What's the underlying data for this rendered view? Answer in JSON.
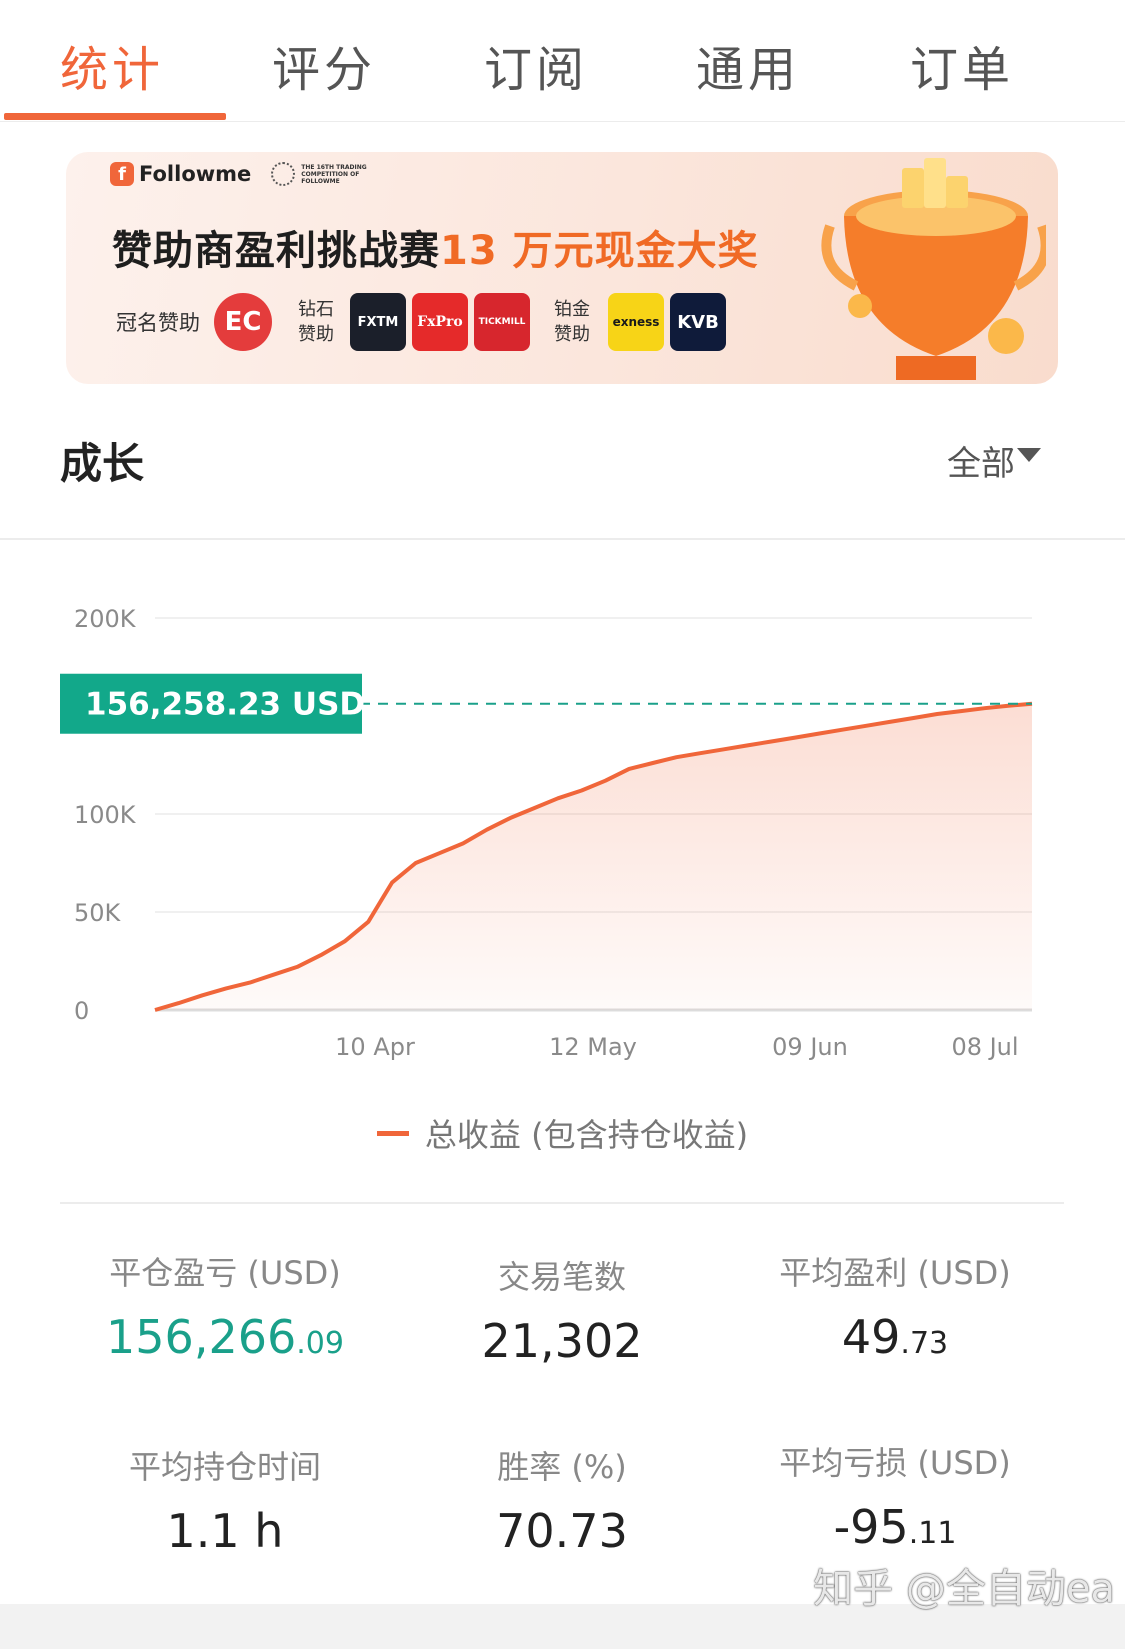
{
  "tabs": [
    {
      "label": "统计",
      "active": true
    },
    {
      "label": "评分",
      "active": false
    },
    {
      "label": "订阅",
      "active": false
    },
    {
      "label": "通用",
      "active": false
    },
    {
      "label": "订单",
      "active": false
    }
  ],
  "banner": {
    "brand": "Followme",
    "brand_icon": "f-logo-icon",
    "competition_text": "THE 16TH TRADING COMPETITION OF FOLLOWME",
    "headline_main": "赞助商盈利挑战赛",
    "headline_highlight": "13 万元现金大奖",
    "title_sponsor_label": "冠名赞助",
    "title_sponsor": "EC",
    "diamond_label": "钻石赞助",
    "diamond_sponsors": [
      "FXTM",
      "FxPro",
      "TICKMILL"
    ],
    "platinum_label": "铂金赞助",
    "platinum_sponsors": [
      "exness",
      "KVB"
    ],
    "colors": {
      "accent": "#f06a25"
    }
  },
  "section": {
    "title": "成长",
    "filter": "全部",
    "filter_icon": "caret-down-icon"
  },
  "chart_data": {
    "type": "area",
    "y_ticks": [
      "200K",
      "100K",
      "50K",
      "0"
    ],
    "y_tick_values": [
      200000,
      100000,
      50000,
      0
    ],
    "x_ticks": [
      "10 Apr",
      "12 May",
      "09 Jun",
      "08 Jul"
    ],
    "series": [
      {
        "name": "总收益 (包含持仓收益)",
        "color": "#f0663a",
        "values": [
          0,
          3500,
          7500,
          11000,
          14000,
          18000,
          22000,
          28000,
          35000,
          45000,
          65000,
          75000,
          80000,
          85000,
          92000,
          98000,
          103000,
          108000,
          112000,
          117000,
          123000,
          126000,
          129000,
          131000,
          133000,
          135000,
          137000,
          139000,
          141000,
          143000,
          145000,
          147000,
          149000,
          151000,
          152500,
          154000,
          155200,
          156258.23
        ]
      }
    ],
    "current_value_label": "156,258.23 USD",
    "current_value": 156258.23,
    "ylim": [
      0,
      200000
    ],
    "grid": true,
    "legend_position": "bottom"
  },
  "stats": [
    {
      "label": "平仓盈亏 (USD)",
      "int": "156,266",
      "dec": ".09",
      "color": "green"
    },
    {
      "label": "交易笔数",
      "int": "21,302",
      "dec": "",
      "color": "default"
    },
    {
      "label": "平均盈利 (USD)",
      "int": "49",
      "dec": ".73",
      "color": "default"
    },
    {
      "label": "平均持仓时间",
      "int": "1.1 h",
      "dec": "",
      "color": "default"
    },
    {
      "label": "胜率 (%)",
      "int": "70.73",
      "dec": "",
      "color": "default"
    },
    {
      "label": "平均亏损 (USD)",
      "int": "-95",
      "dec": ".11",
      "color": "default"
    }
  ],
  "watermark": "知乎 @全自动ea"
}
